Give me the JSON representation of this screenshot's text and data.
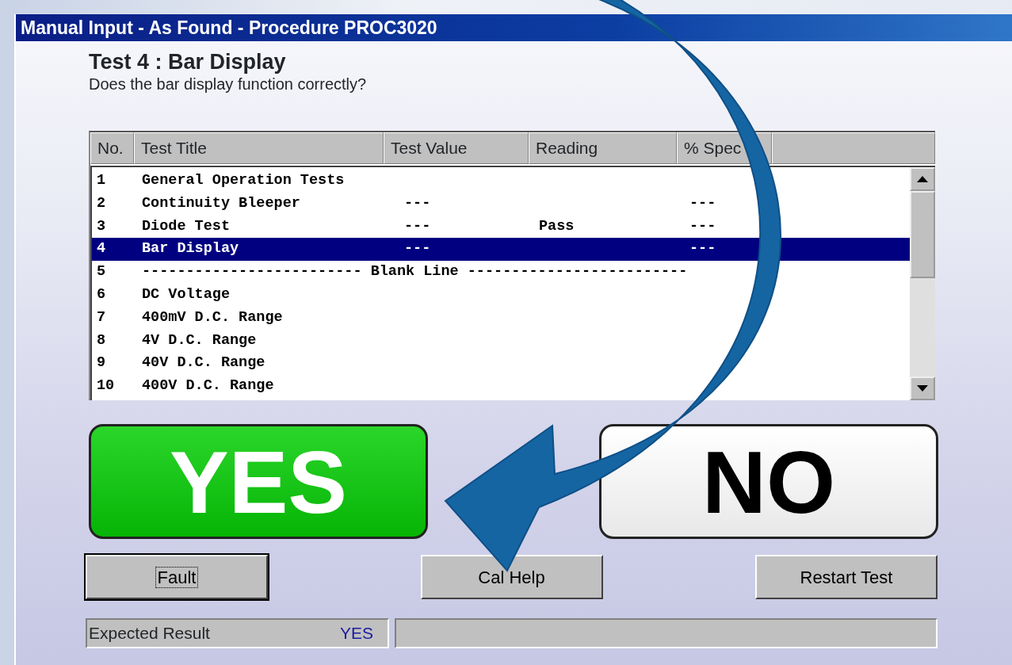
{
  "window": {
    "title": "Manual Input - As Found - Procedure PROC3020"
  },
  "test": {
    "heading": "Test 4 : Bar Display",
    "question": "Does the bar display function correctly?"
  },
  "table": {
    "columns": [
      "No.",
      "Test Title",
      "Test Value",
      "Reading",
      "% Spec"
    ],
    "rows": [
      {
        "kind": "test",
        "no": "1",
        "title": "General Operation Tests",
        "selected": false
      },
      {
        "kind": "test",
        "no": "2",
        "title": "Continuity Bleeper",
        "test_value": "---",
        "spec": "---",
        "selected": false
      },
      {
        "kind": "test",
        "no": "3",
        "title": "Diode Test",
        "test_value": "---",
        "reading": "Pass",
        "spec": "---",
        "selected": false
      },
      {
        "kind": "test",
        "no": "4",
        "title": "Bar Display",
        "test_value": "---",
        "spec": "---",
        "selected": true
      },
      {
        "kind": "separator",
        "no": "5",
        "title": "------------------------- Blank Line -------------------------",
        "selected": false
      },
      {
        "kind": "test",
        "no": "6",
        "title": "DC Voltage",
        "selected": false
      },
      {
        "kind": "test",
        "no": "7",
        "title": "400mV D.C. Range",
        "selected": false
      },
      {
        "kind": "test",
        "no": "8",
        "title": "4V D.C. Range",
        "selected": false
      },
      {
        "kind": "test",
        "no": "9",
        "title": "40V D.C. Range",
        "selected": false
      },
      {
        "kind": "test",
        "no": "10",
        "title": "400V D.C. Range",
        "selected": false
      }
    ]
  },
  "answers": [
    {
      "kind": "yes",
      "label": "YES"
    },
    {
      "kind": "no",
      "label": "NO"
    }
  ],
  "buttons": [
    {
      "label": "Fault",
      "focused": true
    },
    {
      "label": "Cal Help",
      "focused": false
    },
    {
      "label": "Restart Test",
      "focused": false
    }
  ],
  "status_bar": {
    "label": "Expected Result",
    "value": "YES"
  }
}
